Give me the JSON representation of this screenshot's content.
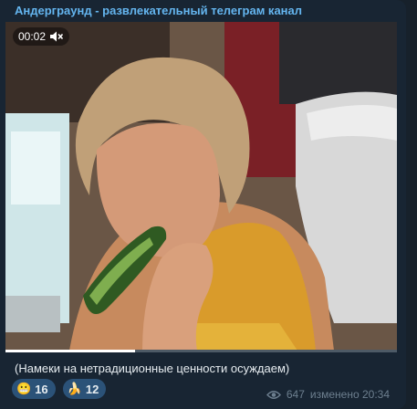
{
  "channel": {
    "title": "Андерграунд - развлекательный телеграм канал"
  },
  "video": {
    "time": "00:02",
    "muted": true,
    "progress": 0.33
  },
  "caption": "(Намеки на нетрадиционные ценности осуждаем)",
  "reactions": [
    {
      "emoji": "😬",
      "count": "16",
      "icon": "grimacing-face-icon"
    },
    {
      "emoji": "🍌",
      "count": "12",
      "icon": "banana-icon"
    }
  ],
  "meta": {
    "views": "647",
    "edited": "изменено 20:34",
    "icon": "eye-icon"
  },
  "colors": {
    "accent": "#64b5ef",
    "bubble": "#182533",
    "reaction_bg": "#2b5278",
    "meta": "#6d7f8f"
  }
}
